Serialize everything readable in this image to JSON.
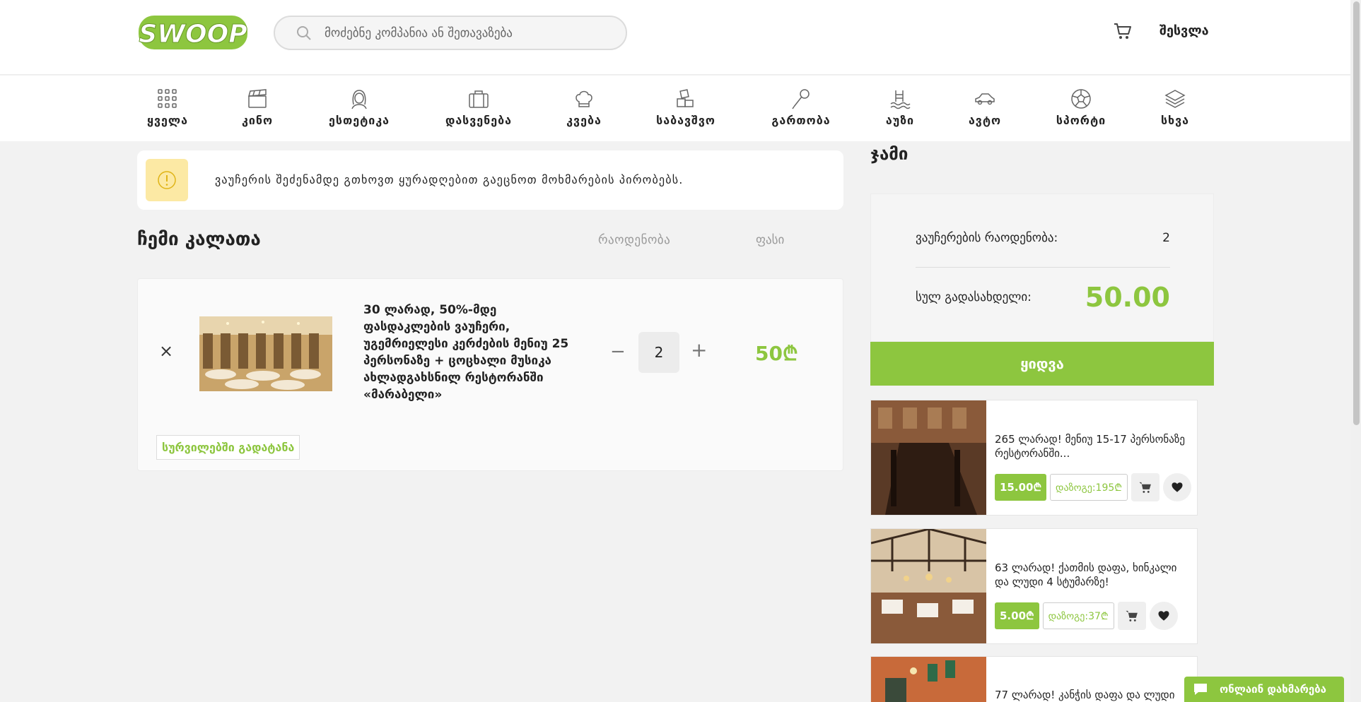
{
  "header": {
    "logo_text": "SWOOP",
    "search_placeholder": "მოძებნე კომპანია ან შეთავაზება",
    "login_label": "შესვლა"
  },
  "categories": [
    {
      "label": "ყველა",
      "icon": "grid-icon"
    },
    {
      "label": "კინო",
      "icon": "clapperboard-icon"
    },
    {
      "label": "ესთეტიკა",
      "icon": "woman-face-icon"
    },
    {
      "label": "დასვენება",
      "icon": "suitcase-icon"
    },
    {
      "label": "კვება",
      "icon": "chef-hat-icon"
    },
    {
      "label": "საბავშვო",
      "icon": "toy-blocks-icon"
    },
    {
      "label": "გართობა",
      "icon": "microphone-icon"
    },
    {
      "label": "აუზი",
      "icon": "pool-icon"
    },
    {
      "label": "ავტო",
      "icon": "car-icon"
    },
    {
      "label": "სპორტი",
      "icon": "ball-icon"
    },
    {
      "label": "სხვა",
      "icon": "layers-icon"
    }
  ],
  "notice": {
    "text": "ვაუჩერის შეძენამდე გთხოვთ ყურადღებით გაეცნოთ მოხმარების პირობებს."
  },
  "cart": {
    "title": "ჩემი კალათა",
    "col_quantity": "რაოდენობა",
    "col_price": "ფასი",
    "item": {
      "title": "30 ლარად, 50%-მდე ფასდაკლების ვაუჩერი, უგემრიელესი კერძების მენიუ 25 პერსონაზე + ცოცხალი მუსიკა ახლადგახსნილ რესტორანში «მარაბელი»",
      "quantity": "2",
      "price": "50₾",
      "remove": "×",
      "minus": "−",
      "plus": "+",
      "wishlist_label": "სურვილებში გადატანა"
    }
  },
  "summary": {
    "title": "ჯამი",
    "count_label": "ვაუჩერების რაოდენობა:",
    "count_value": "2",
    "total_label": "სულ გადასახდელი:",
    "total_value": "50.00",
    "buy_label": "ყიდვა"
  },
  "offers": [
    {
      "title": "265 ლარად! მენიუ 15-17 პერსონაზე რესტორანში...",
      "price": "15.00₾",
      "save": "დაზოგე:195₾"
    },
    {
      "title": "63 ლარად! ქათმის დაფა, ხინკალი და ლუდი 4 სტუმარზე!",
      "price": "5.00₾",
      "save": "დაზოგე:37₾"
    },
    {
      "title": "77 ლარად! კანჭის დაფა და ლუდი",
      "price": "",
      "save": ""
    }
  ],
  "chat": {
    "label": "ონლაინ დახმარება"
  },
  "colors": {
    "brand": "#8dc63f",
    "notice_bg": "#fce9a4"
  }
}
